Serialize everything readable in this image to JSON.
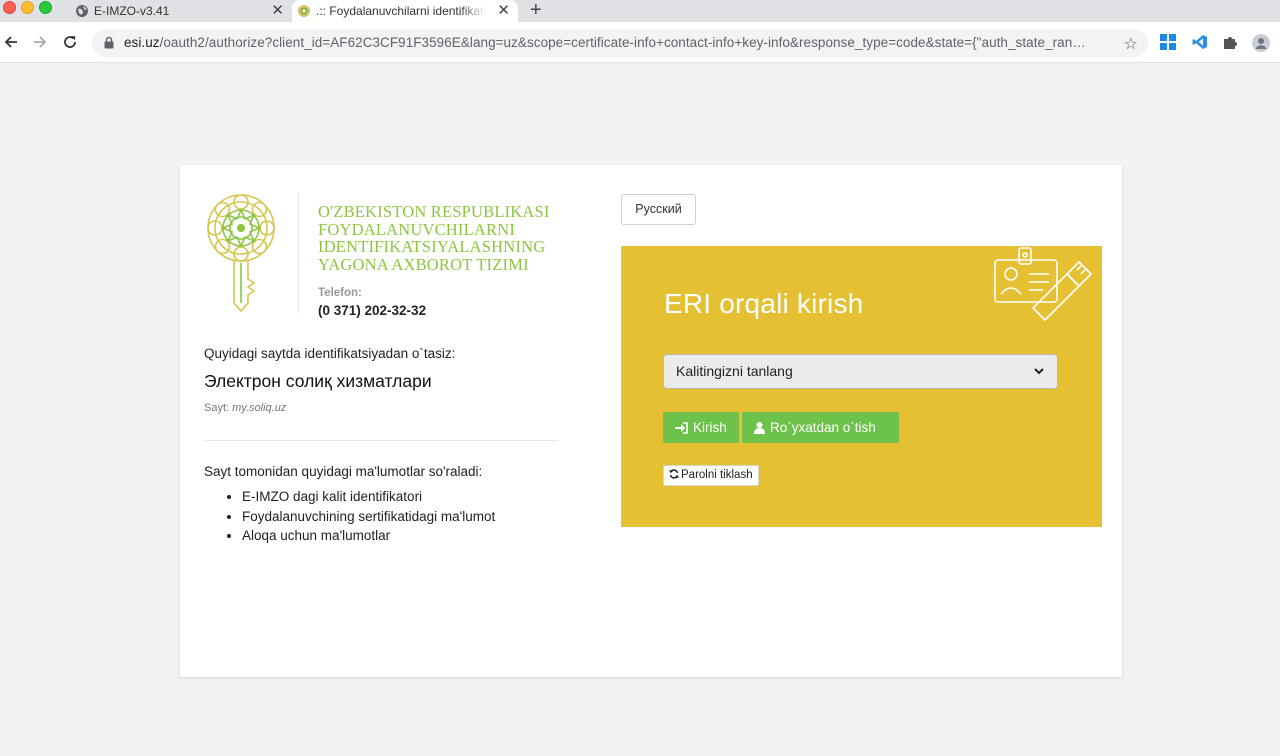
{
  "browser": {
    "tabs": [
      {
        "title": "E-IMZO-v3.41",
        "favicon": "globe-icon"
      },
      {
        "title": ".:: Foydalanuvchilarni identifikatsiyalash",
        "favicon": "emblem-icon",
        "active": true
      }
    ],
    "url_host": "esi.uz",
    "url_rest": "/oauth2/authorize?client_id=AF62C3CF91F3596E&lang=uz&scope=certificate-info+contact-info+key-info&response_type=code&state={\"auth_state_ran…"
  },
  "header": {
    "org_name": "O'ZBEKISTON RESPUBLIKASI FOYDALANUVCHILARNI IDENTIFIKATSIYALASHNING YAGONA AXBOROT TIZIMI",
    "phone_label": "Telefon:",
    "phone": "(0 371) 202-32-32"
  },
  "service": {
    "intro": "Quyidagi saytda identifikatsiyadan o`tasiz:",
    "name": "Электрон солиқ хизматлари",
    "site_label": "Sayt:",
    "site_url": "my.soliq.uz"
  },
  "requested": {
    "title": "Sayt tomonidan quyidagi ma'lumotlar so'raladi:",
    "items": [
      "E-IMZO dagi kalit identifikatori",
      "Foydalanuvchining sertifikatidagi ma'lumot",
      "Aloqa uchun ma'lumotlar"
    ]
  },
  "lang_button": "Русский",
  "login": {
    "title": "ERI orqali kirish",
    "select_placeholder": "Kalitingizni tanlang",
    "login_button": "Kirish",
    "register_button": "Ro`yxatdan o`tish",
    "reset_password": "Parolni tiklash"
  },
  "colors": {
    "panel_bg": "#e5c033",
    "button_green": "#6cc24a",
    "org_green": "#8cc63f"
  }
}
